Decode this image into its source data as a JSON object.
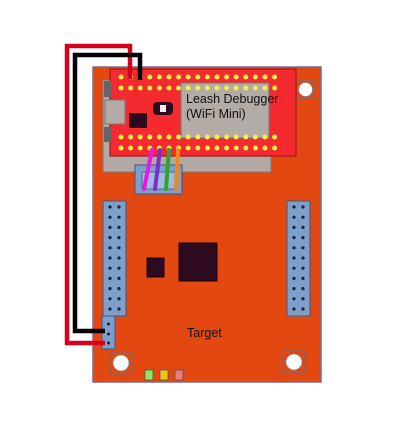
{
  "labels": {
    "debugger_line1": "Leash Debugger",
    "debugger_line2": "(WiFi Mini)",
    "target": "Target"
  },
  "colors": {
    "target_board": "#e2480f",
    "debugger_board": "#f52a2f",
    "connector": "#7d9fc9",
    "module": "#b2aba6",
    "chip": "#2e0a1e",
    "header_pin": "#f6ef49",
    "wire_red": "#d7001f",
    "wire_black": "#000000",
    "wire_magenta": "#e817e8",
    "wire_purple": "#7b2fc8",
    "wire_green": "#2fa52f",
    "wire_orange": "#f08a17",
    "led_green": "#8ee65a",
    "led_yellow": "#f2c21b",
    "led_pink": "#f07979"
  },
  "icons": {
    "mounting_hole": "white-rounded-square",
    "led": "small-colored-square"
  }
}
